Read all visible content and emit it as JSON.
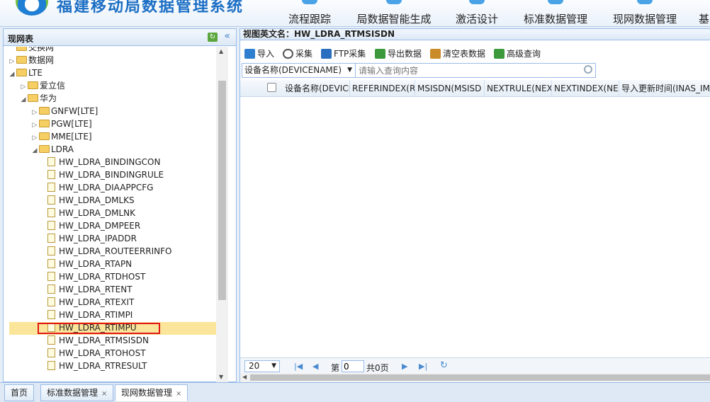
{
  "header": {
    "title": "福建移动局数据管理系统",
    "nav": [
      "流程跟踪",
      "局数据智能生成",
      "激活设计",
      "标准数据管理",
      "现网数据管理",
      "基"
    ]
  },
  "left_panel": {
    "title": "现网表",
    "tree": [
      {
        "label": "交换网",
        "level": 1,
        "type": "folder",
        "arrow": "",
        "partial": true
      },
      {
        "label": "数据网",
        "level": 1,
        "type": "folder",
        "arrow": "▷"
      },
      {
        "label": "LTE",
        "level": 1,
        "type": "folder",
        "arrow": "◢"
      },
      {
        "label": "爱立信",
        "level": 2,
        "type": "folder",
        "arrow": "▷"
      },
      {
        "label": "华为",
        "level": 2,
        "type": "folder",
        "arrow": "◢"
      },
      {
        "label": "GNFW[LTE]",
        "level": 3,
        "type": "folder",
        "arrow": "▷"
      },
      {
        "label": "PGW[LTE]",
        "level": 3,
        "type": "folder",
        "arrow": "▷"
      },
      {
        "label": "MME[LTE]",
        "level": 3,
        "type": "folder",
        "arrow": "▷"
      },
      {
        "label": "LDRA",
        "level": 3,
        "type": "folder",
        "arrow": "◢"
      },
      {
        "label": "HW_LDRA_BINDINGCON",
        "level": 4,
        "type": "file"
      },
      {
        "label": "HW_LDRA_BINDINGRULE",
        "level": 4,
        "type": "file"
      },
      {
        "label": "HW_LDRA_DIAAPPCFG",
        "level": 4,
        "type": "file"
      },
      {
        "label": "HW_LDRA_DMLKS",
        "level": 4,
        "type": "file"
      },
      {
        "label": "HW_LDRA_DMLNK",
        "level": 4,
        "type": "file"
      },
      {
        "label": "HW_LDRA_DMPEER",
        "level": 4,
        "type": "file"
      },
      {
        "label": "HW_LDRA_IPADDR",
        "level": 4,
        "type": "file"
      },
      {
        "label": "HW_LDRA_ROUTEERRINFO",
        "level": 4,
        "type": "file"
      },
      {
        "label": "HW_LDRA_RTAPN",
        "level": 4,
        "type": "file"
      },
      {
        "label": "HW_LDRA_RTDHOST",
        "level": 4,
        "type": "file"
      },
      {
        "label": "HW_LDRA_RTENT",
        "level": 4,
        "type": "file"
      },
      {
        "label": "HW_LDRA_RTEXIT",
        "level": 4,
        "type": "file"
      },
      {
        "label": "HW_LDRA_RTIMPI",
        "level": 4,
        "type": "file"
      },
      {
        "label": "HW_LDRA_RTIMPU",
        "level": 4,
        "type": "file"
      },
      {
        "label": "HW_LDRA_RTMSISDN",
        "level": 4,
        "type": "file",
        "selected": true
      },
      {
        "label": "HW_LDRA_RTOHOST",
        "level": 4,
        "type": "file"
      },
      {
        "label": "HW_LDRA_RTRESULT",
        "level": 4,
        "type": "file"
      }
    ]
  },
  "right_panel": {
    "view_title": "视图英文名：HW_LDRA_RTMSISDN",
    "toolbar": [
      {
        "label": "导入",
        "icon": "arrow-up-icon",
        "color": "#2f7fd0"
      },
      {
        "label": "采集",
        "icon": "cloud-icon",
        "color": "#555555"
      },
      {
        "label": "FTP采集",
        "icon": "ftp-icon",
        "color": "#2a6fbf"
      },
      {
        "label": "导出数据",
        "icon": "export-icon",
        "color": "#3c9a3c"
      },
      {
        "label": "清空表数据",
        "icon": "broom-icon",
        "color": "#c98a2a"
      },
      {
        "label": "高级查询",
        "icon": "advanced-search-icon",
        "color": "#3c9a3c"
      }
    ],
    "search": {
      "field": "设备名称(DEVICENAME)",
      "placeholder": "请输入查询内容"
    },
    "columns": [
      "设备名称(DEVICI",
      "REFERINDEX(RE",
      "MSISDN(MSISD",
      "NEXTRULE(NEXT",
      "NEXTINDEX(NE",
      "导入更新时间(INAS_IM"
    ],
    "pager": {
      "page_size": "20",
      "page_prefix": "第",
      "page_value": "0",
      "total": "共0页"
    }
  },
  "bottom_tabs": [
    {
      "label": "首页",
      "closable": false
    },
    {
      "label": "标准数据管理",
      "closable": true
    },
    {
      "label": "现网数据管理",
      "closable": true,
      "active": true
    }
  ]
}
